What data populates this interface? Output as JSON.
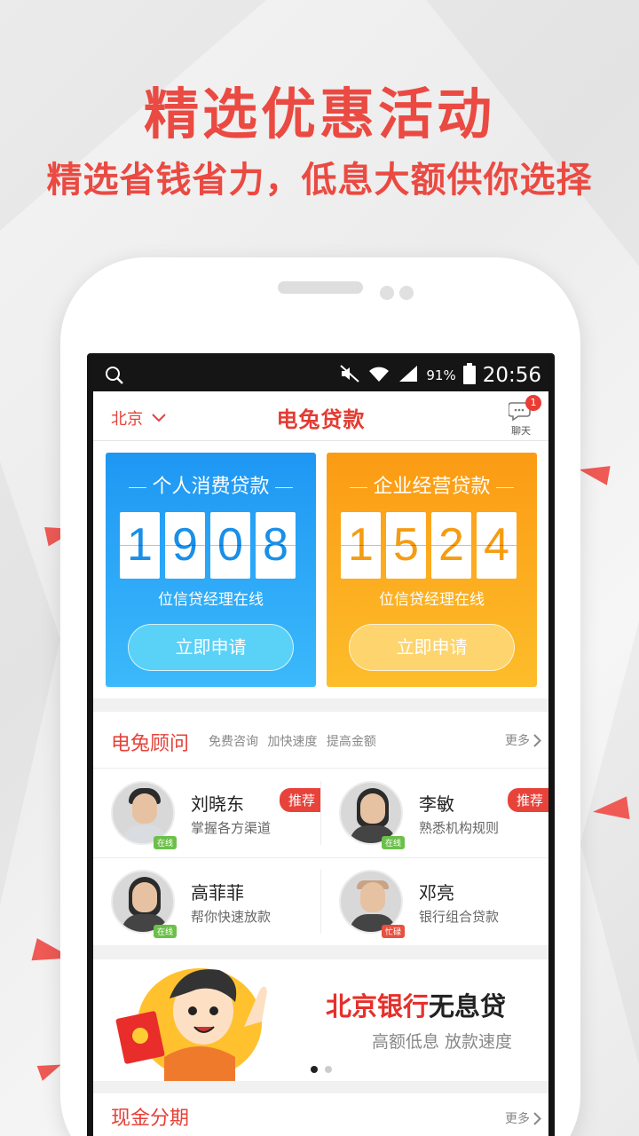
{
  "promo": {
    "title": "精选优惠活动",
    "subtitle": "精选省钱省力，低息大额供你选择"
  },
  "status_bar": {
    "battery": "91%",
    "time": "20:56",
    "icons": [
      "search-icon",
      "mute-icon",
      "wifi-icon",
      "signal-icon",
      "battery-icon"
    ]
  },
  "app_bar": {
    "city": "北京",
    "brand": "电兔贷款",
    "chat_label": "聊天",
    "chat_badge": "1"
  },
  "loan_cards": [
    {
      "title": "个人消费贷款",
      "digits": [
        "1",
        "9",
        "0",
        "8"
      ],
      "online_text": "位信贷经理在线",
      "button": "立即申请",
      "color": "#1e97f3"
    },
    {
      "title": "企业经营贷款",
      "digits": [
        "1",
        "5",
        "2",
        "4"
      ],
      "online_text": "位信贷经理在线",
      "button": "立即申请",
      "color": "#fb9b14"
    }
  ],
  "advisors": {
    "title": "电兔顾问",
    "tags": "免费咨询 加快速度 提高金额",
    "more": "更多",
    "items": [
      {
        "name": "刘晓东",
        "desc": "掌握各方渠道",
        "status": "在线",
        "badge": "推荐"
      },
      {
        "name": "李敏",
        "desc": "熟悉机构规则",
        "status": "在线",
        "badge": "推荐"
      },
      {
        "name": "高菲菲",
        "desc": "帮你快速放款",
        "status": "在线",
        "badge": ""
      },
      {
        "name": "邓亮",
        "desc": "银行组合贷款",
        "status": "忙碌",
        "badge": ""
      }
    ]
  },
  "banner": {
    "title_red": "北京银行",
    "title_black": "无息贷",
    "subtitle": "高额低息 放款速度"
  },
  "cash": {
    "title": "现金分期",
    "more": "更多"
  },
  "colors": {
    "accent_red": "#e6413a",
    "blue_card": "#1e97f3",
    "orange_card": "#fb9b14"
  }
}
